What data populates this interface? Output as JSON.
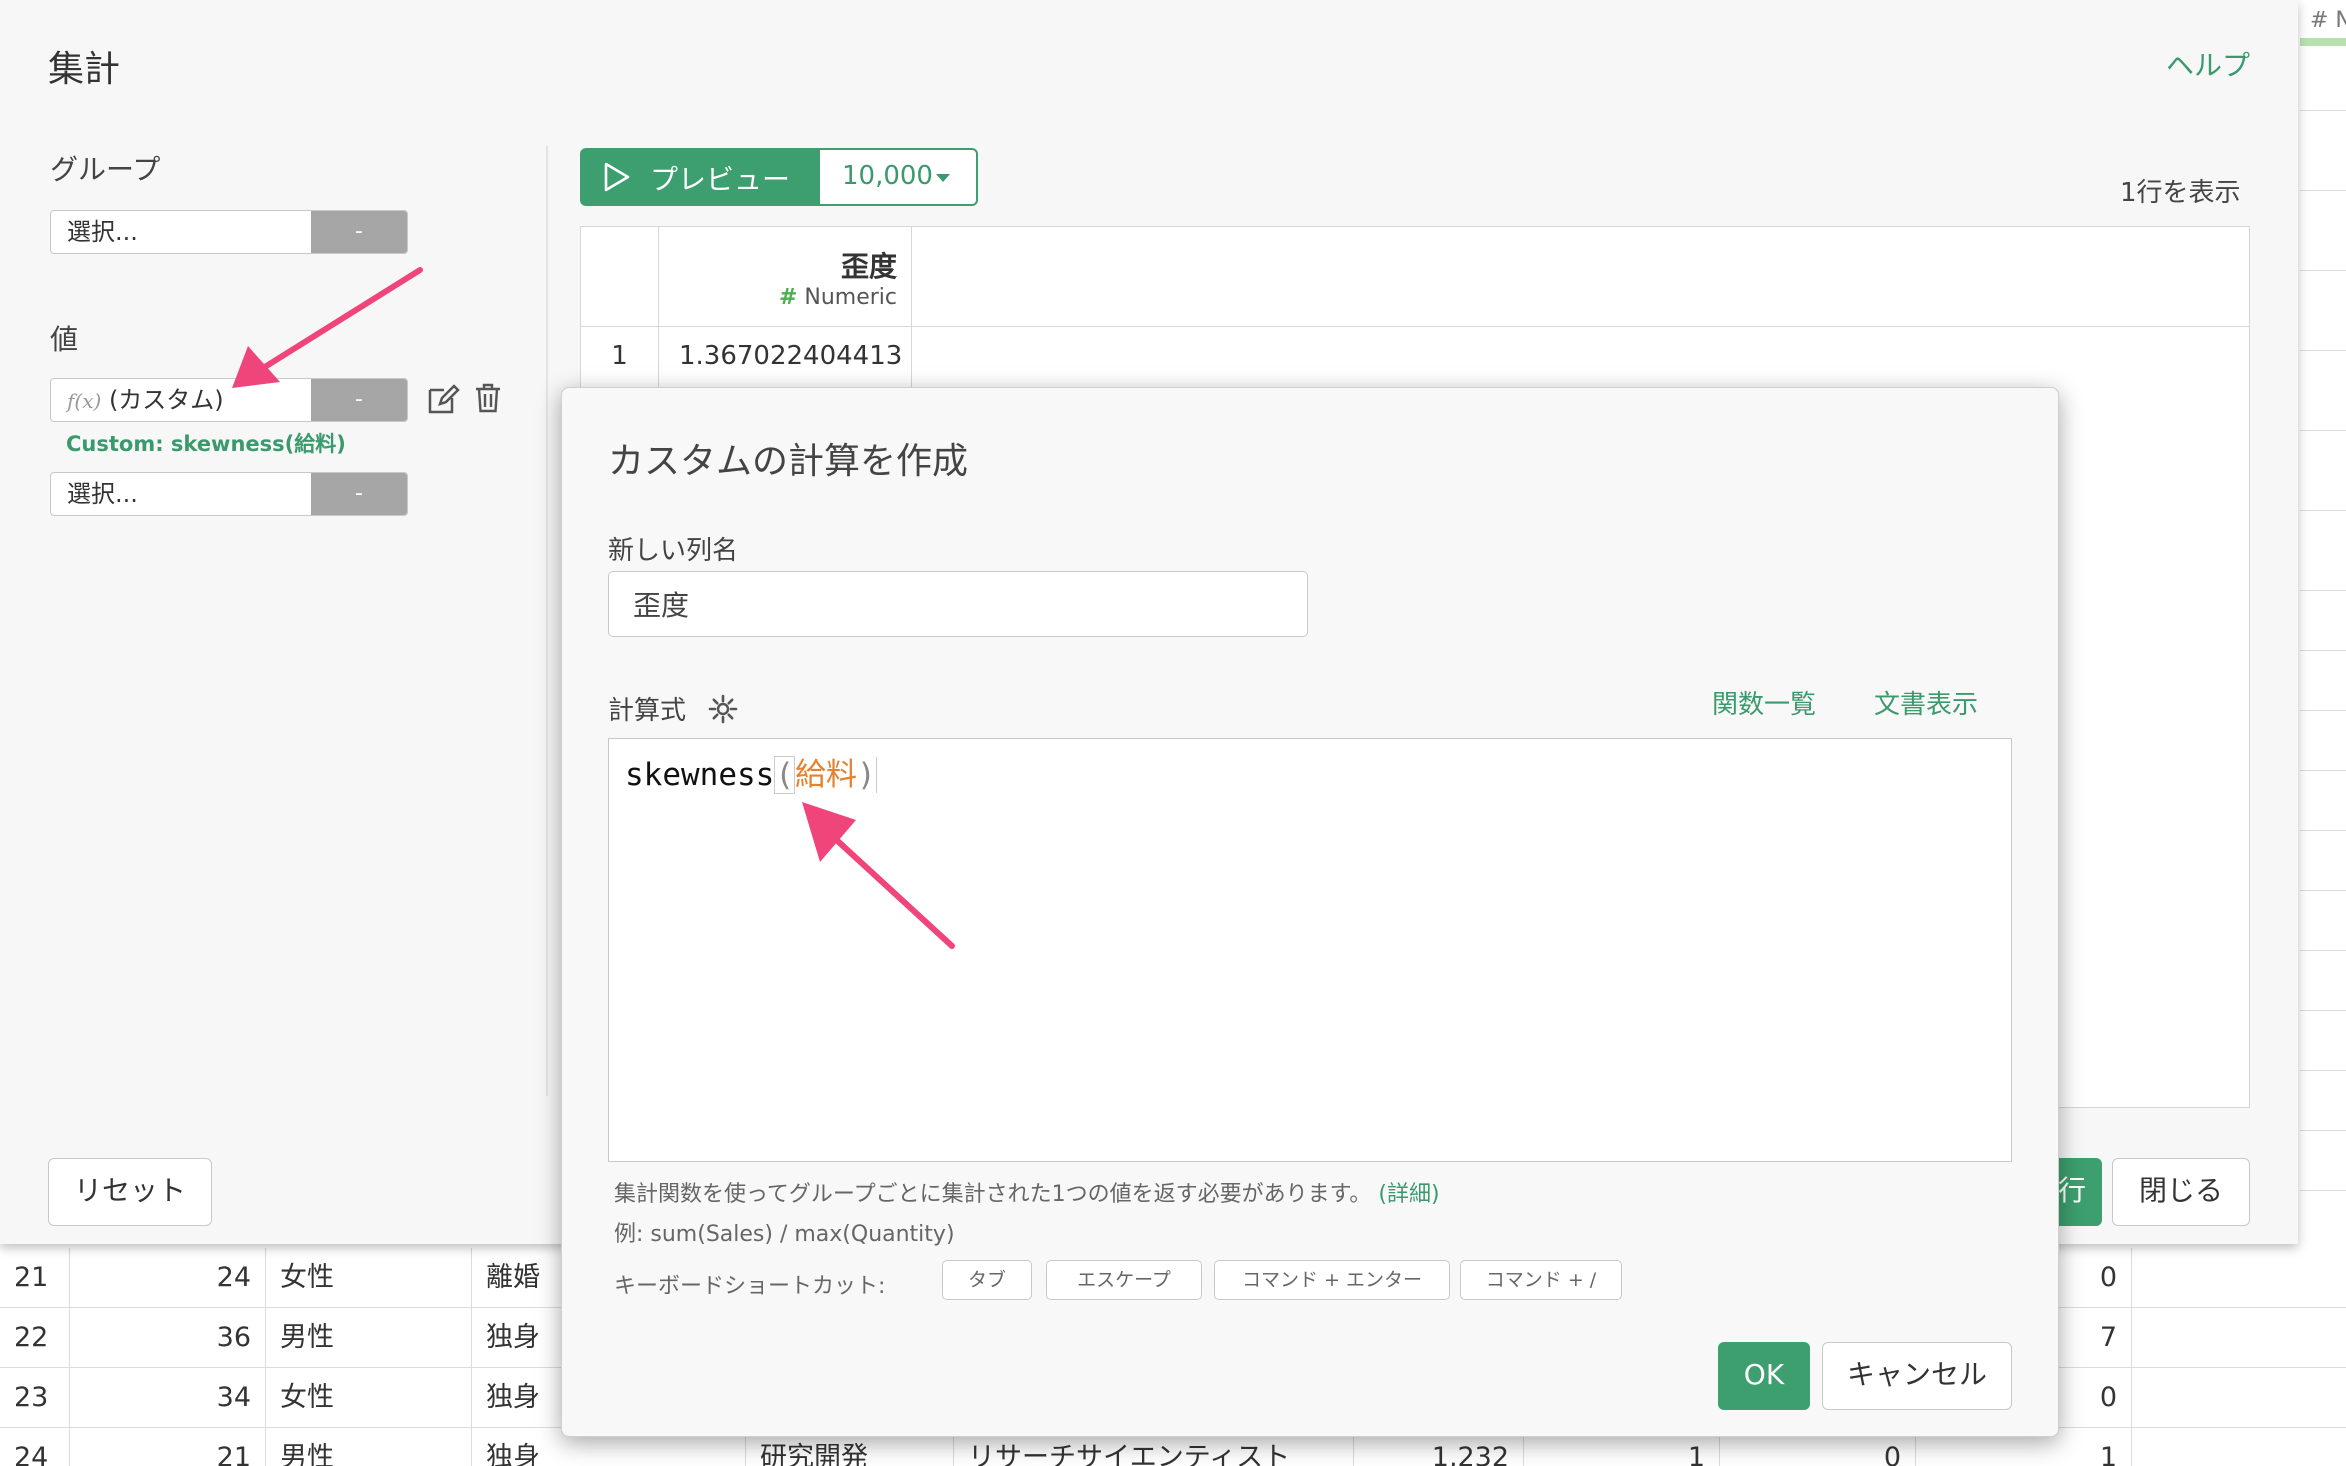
{
  "background_table": {
    "column_header_partial": "# Nu",
    "rows": [
      {
        "row": "21",
        "age": "24",
        "gender": "女性",
        "marital": "離婚",
        "c_right": "0"
      },
      {
        "row": "22",
        "age": "36",
        "gender": "男性",
        "marital": "独身",
        "c_right": "7"
      },
      {
        "row": "23",
        "age": "34",
        "gender": "女性",
        "marital": "独身",
        "c_right": "0"
      },
      {
        "row": "24",
        "age": "21",
        "gender": "男性",
        "marital": "独身",
        "dept": "研究開発",
        "role": "リサーチサイエンティスト",
        "num1": "1,232",
        "num2": "1",
        "num3": "0",
        "c_right": "1"
      }
    ]
  },
  "panel": {
    "title": "集計",
    "help_link": "ヘルプ",
    "group_label": "グループ",
    "group_select": {
      "value": "選択...",
      "remove": "-"
    },
    "value_label": "値",
    "value_select": {
      "icon_text": "f(x)",
      "value": "(カスタム)",
      "remove": "-"
    },
    "custom_note": "Custom: skewness(給料)",
    "value_select_2": {
      "value": "選択...",
      "remove": "-"
    },
    "preview_button": "プレビュー",
    "row_count_select": "10,000",
    "rows_shown": "1行を表示",
    "preview_table": {
      "column_name": "歪度",
      "column_type": "Numeric",
      "type_symbol": "#",
      "rows": [
        {
          "index": "1",
          "value": "1.367022404413"
        }
      ]
    },
    "reset_button": "リセット",
    "run_button_partial": "行",
    "close_button": "閉じる"
  },
  "dialog": {
    "title": "カスタムの計算を作成",
    "new_column_label": "新しい列名",
    "new_column_value": "歪度",
    "formula_label": "計算式",
    "function_list_link": "関数一覧",
    "docs_link": "文書表示",
    "formula": {
      "function": "skewness",
      "open_paren": "(",
      "argument": "給料",
      "close_paren": ")"
    },
    "hint_text": "集計関数を使ってグループごとに集計された1つの値を返す必要があります。",
    "hint_link": "(詳細)",
    "example_text": "例: sum(Sales) / max(Quantity)",
    "shortcuts_label": "キーボードショートカット:",
    "shortcuts": [
      "タブ",
      "エスケープ",
      "コマンド + エンター",
      "コマンド + /"
    ],
    "ok_button": "OK",
    "cancel_button": "キャンセル"
  },
  "colors": {
    "accent_green": "#3d9f6f",
    "arrow_pink": "#f0457a",
    "formula_orange": "#e5822e",
    "select_remove_gray": "#a6a6a6"
  }
}
